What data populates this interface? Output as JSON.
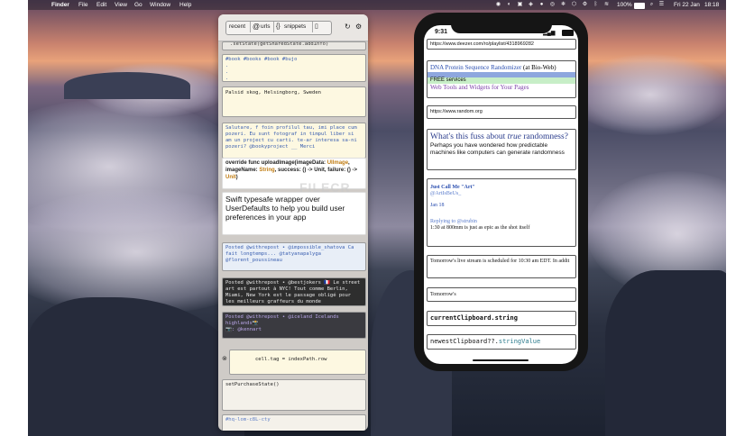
{
  "menubar": {
    "apple": "",
    "items": [
      "Finder",
      "File",
      "Edit",
      "View",
      "Go",
      "Window",
      "Help"
    ],
    "status": {
      "battery": "100%",
      "date": "Fri 22 Jan",
      "time": "18:18"
    }
  },
  "watermark": "FILECR",
  "clipboard": {
    "tabs": {
      "recent": "recent",
      "urls": "urls",
      "snippets": "snippets"
    },
    "cards": [
      {
        "text": ".setState(getSharedState.addInfo)"
      },
      {
        "text": "#book #books #book #bujo\n.\n.\n.\n#bookblog"
      },
      {
        "text": "Palsid skog, Helsingborg, Sweden"
      },
      {
        "text": "Salutare, f foin profilul tau, imi place cum pozeri. Eu sunt fotograf in timpul liber si am un project cu carti. te-ar interesa sa-ni pozeri? @bookyproject __ Merci"
      },
      {
        "text_a": "override func uploadImage(imageData: ",
        "text_b": "UIImage",
        "text_c": ", imageName: ",
        "text_d": "String",
        "text_e": ", success: () -> Unit, failure: () -> ",
        "text_f": "Unit",
        "text_g": ")"
      },
      {
        "text": "Swift typesafe wrapper over UserDefaults to help you build user preferences in your app"
      },
      {
        "text": "Posted @withrepost • @impossible_shatova Ca fait longtemps... @tatyanapalyga @florent_poussineau"
      },
      {
        "text": "Posted @withrepost • @bestjokers 🇫🇷 Le street art est partout à NYC! Tout comme Berlin, Miami, New York est le passage obligé pour les meilleurs graffeurs du monde"
      },
      {
        "text": "Posted @withrepost • @iceland Icelands highlands📸\n📷: @kennart"
      },
      {
        "text": "cell.tag = indexPath.row"
      },
      {
        "text": "setPurchaseState()"
      },
      {
        "text": "#hq-lom-c8L-cty"
      }
    ]
  },
  "phone": {
    "time": "9:31",
    "cards": [
      {
        "url": "https://www.deezer.com/ro/playlist/4318969282"
      },
      {
        "title": "DNA Protein Sequence Randomizer",
        "suffix": " (at Bio-Web)",
        "free": "FREE services",
        "tools": "Web Tools and Widgets for Your Pages"
      },
      {
        "url": "https://www.random.org"
      },
      {
        "heading_a": "What's this fuss about ",
        "heading_b": "true",
        "heading_c": " randomness?",
        "body": "Perhaps you have wondered how predictable machines like computers can generate randomness"
      },
      {
        "name": "Just Call Me \"Art\"",
        "handle": "@ArtIsBeUs_",
        "date": "Jan 18",
        "reply": "Replying to @strubin",
        "body": "1:30 at 800mm is just as epic as the shot itself"
      },
      {
        "body": "Tomorrow's live stream is scheduled for 10:30 am EDT. In addit"
      },
      {
        "body": "Tomorrow's"
      },
      {
        "code": "currentClipboard.string"
      },
      {
        "code_a": "newestClipboard??.",
        "code_b": "stringValue"
      }
    ]
  }
}
